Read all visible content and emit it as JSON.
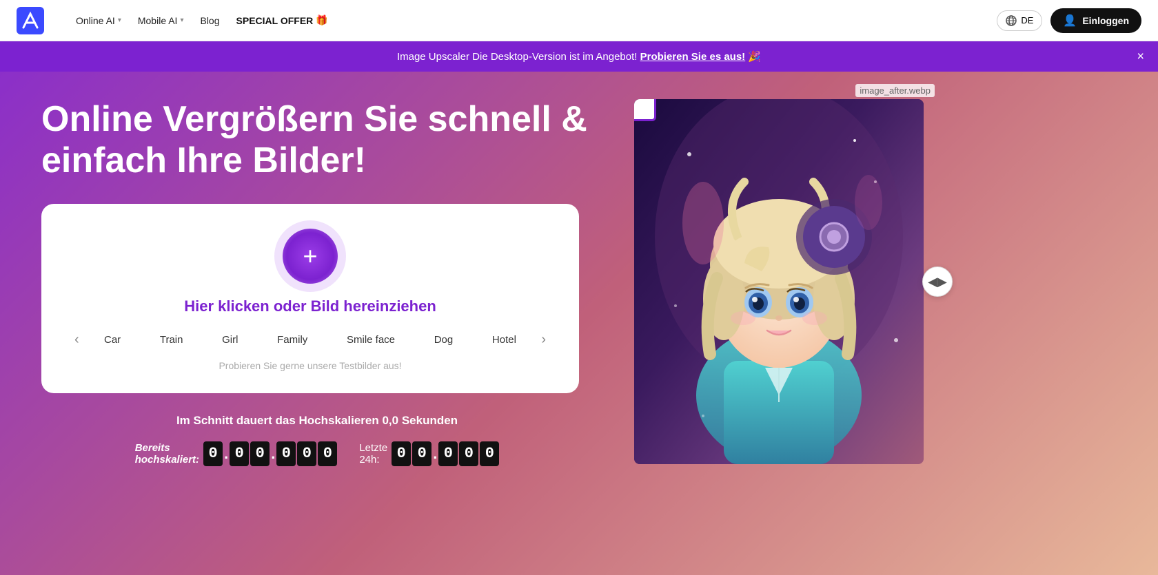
{
  "navbar": {
    "logo_alt": "AI Logo",
    "online_ai_label": "Online AI",
    "mobile_ai_label": "Mobile AI",
    "blog_label": "Blog",
    "special_offer_label": "SPECIAL OFFER",
    "special_offer_icon": "🎁",
    "lang_label": "DE",
    "login_label": "Einloggen"
  },
  "banner": {
    "text_prefix": "Image Upscaler Die Desktop-Version ist im Angebot!",
    "link_text": "Probieren Sie es aus!",
    "emoji": "🎉",
    "close_label": "×"
  },
  "hero": {
    "title_line1": "Online Vergrößern Sie schnell &",
    "title_line2": "einfach Ihre Bilder!",
    "upload_hint_label": "Hier klicken oder Bild hereinziehen",
    "sample_label": "Probieren Sie gerne unsere Testbilder aus!",
    "sample_items": [
      "Car",
      "Train",
      "Girl",
      "Family",
      "Smile face",
      "Dog",
      "Hotel"
    ],
    "stats_time_text": "Im Schnitt dauert das Hochskalieren 0,0 Sekunden",
    "counter_already_label": "Bereits hochskaliert:",
    "counter_last24_label": "Letzte 24h:",
    "already_digits": [
      "0",
      ".",
      "0",
      "0",
      ".",
      "0",
      "0",
      "0"
    ],
    "last24_digits": [
      "0",
      "0",
      ".",
      "0",
      "0",
      "0"
    ],
    "image_after_label": "image_after.webp"
  }
}
